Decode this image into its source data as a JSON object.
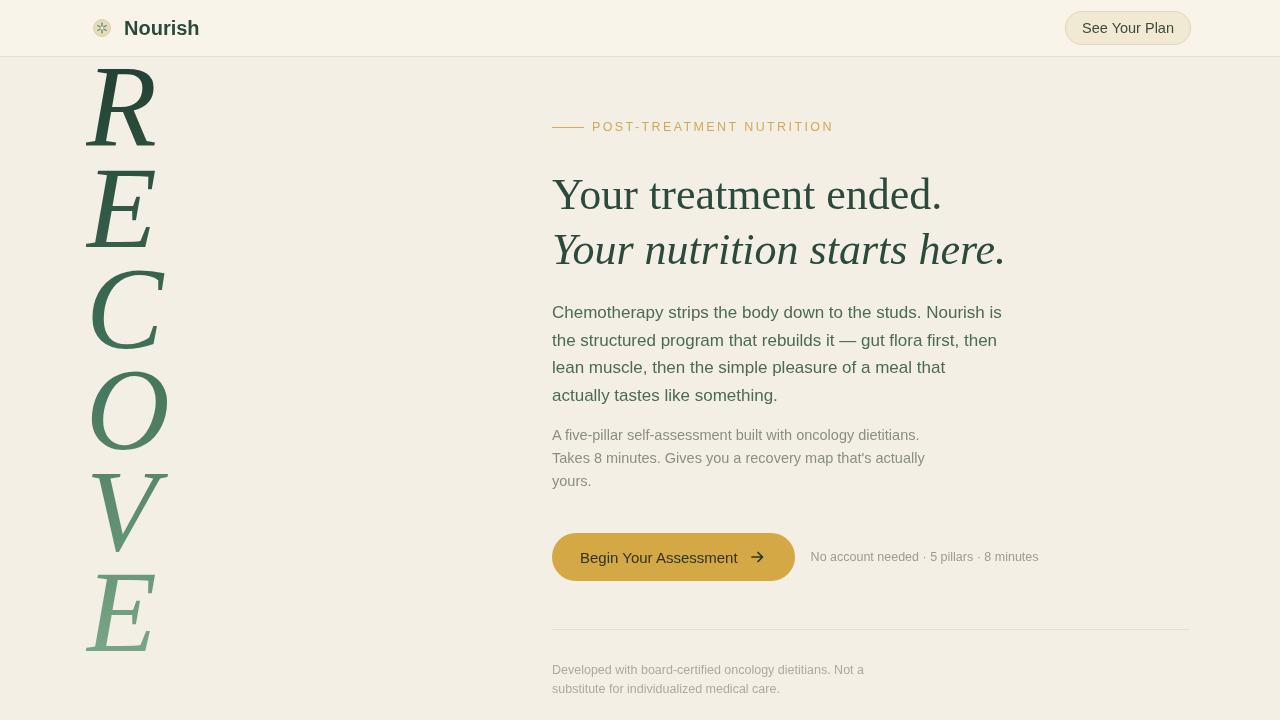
{
  "header": {
    "brand": "Nourish",
    "button": "See Your Plan"
  },
  "vertical_word": "RECOVE",
  "hero": {
    "eyebrow": "POST-TREATMENT NUTRITION",
    "headline": [
      {
        "text": "Your treatment ended.",
        "italic": false
      },
      {
        "text": "Your nutrition starts here.",
        "italic": true
      }
    ],
    "lead": "Chemotherapy strips the body down to the studs. Nourish is the structured program that rebuilds it — gut flora first, then lean muscle, then the simple pleasure of a meal that actually tastes like something.",
    "detail": "A five-pillar self-assessment built with oncology dietitians. Takes 8 minutes. Gives you a recovery map that's actually yours.",
    "cta": "Begin Your Assessment",
    "cta_note": "No account needed · 5 pillars · 8 minutes",
    "disclaimer": "Developed with board-certified oncology dietitians. Not a substitute for individualized medical care."
  }
}
